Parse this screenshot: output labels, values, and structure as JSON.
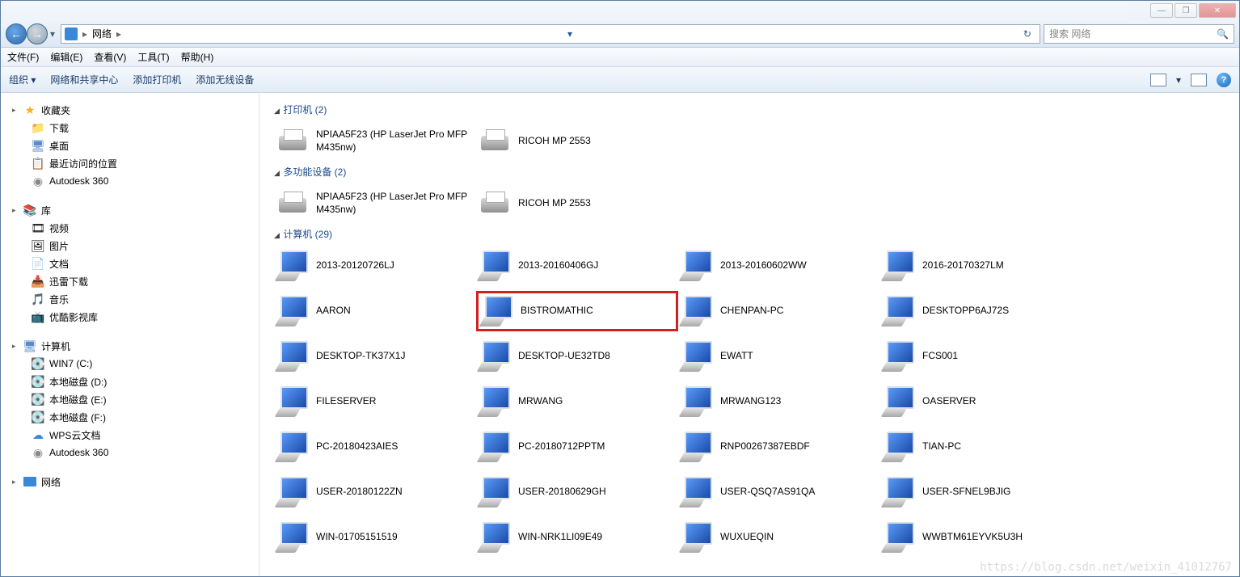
{
  "titlebar": {
    "min": "—",
    "max": "❐",
    "close": "✕"
  },
  "nav": {
    "back": "←",
    "forward": "→",
    "breadcrumb_root": "▸",
    "breadcrumb_loc": "网络",
    "breadcrumb_sep": "▸",
    "refresh": "↻",
    "search_placeholder": "搜索 网络",
    "search_icon": "🔍"
  },
  "menubar": {
    "file": "文件(F)",
    "edit": "编辑(E)",
    "view": "查看(V)",
    "tools": "工具(T)",
    "help": "帮助(H)"
  },
  "toolbar": {
    "organize": "组织 ▾",
    "network_center": "网络和共享中心",
    "add_printer": "添加打印机",
    "add_wireless": "添加无线设备",
    "help": "?"
  },
  "sidebar": {
    "favorites": {
      "label": "收藏夹",
      "items": [
        "下载",
        "桌面",
        "最近访问的位置",
        "Autodesk 360"
      ]
    },
    "libraries": {
      "label": "库",
      "items": [
        "视频",
        "图片",
        "文档",
        "迅雷下载",
        "音乐",
        "优酷影视库"
      ]
    },
    "computer": {
      "label": "计算机",
      "items": [
        "WIN7 (C:)",
        "本地磁盘 (D:)",
        "本地磁盘 (E:)",
        "本地磁盘 (F:)",
        "WPS云文档",
        "Autodesk 360"
      ]
    },
    "network": {
      "label": "网络"
    }
  },
  "content": {
    "groups": [
      {
        "header": "打印机 (2)",
        "type": "printer",
        "cols": 2,
        "items": [
          {
            "label": "NPIAA5F23 (HP LaserJet Pro MFP M435nw)"
          },
          {
            "label": "RICOH MP 2553"
          }
        ]
      },
      {
        "header": "多功能设备 (2)",
        "type": "printer",
        "cols": 2,
        "items": [
          {
            "label": "NPIAA5F23 (HP LaserJet Pro MFP M435nw)"
          },
          {
            "label": "RICOH MP 2553"
          }
        ]
      },
      {
        "header": "计算机 (29)",
        "type": "computer",
        "cols": 4,
        "items": [
          {
            "label": "2013-20120726LJ"
          },
          {
            "label": "2013-20160406GJ"
          },
          {
            "label": "2013-20160602WW"
          },
          {
            "label": "2016-20170327LM"
          },
          {
            "label": "AARON"
          },
          {
            "label": "BISTROMATHIC",
            "highlight": true
          },
          {
            "label": "CHENPAN-PC"
          },
          {
            "label": "DESKTOPP6AJ72S"
          },
          {
            "label": "DESKTOP-TK37X1J"
          },
          {
            "label": "DESKTOP-UE32TD8"
          },
          {
            "label": "EWATT"
          },
          {
            "label": "FCS001"
          },
          {
            "label": "FILESERVER"
          },
          {
            "label": "MRWANG"
          },
          {
            "label": "MRWANG123"
          },
          {
            "label": "OASERVER"
          },
          {
            "label": "PC-20180423AIES"
          },
          {
            "label": "PC-20180712PPTM"
          },
          {
            "label": "RNP00267387EBDF"
          },
          {
            "label": "TIAN-PC"
          },
          {
            "label": "USER-20180122ZN"
          },
          {
            "label": "USER-20180629GH"
          },
          {
            "label": "USER-QSQ7AS91QA"
          },
          {
            "label": "USER-SFNEL9BJIG"
          },
          {
            "label": "WIN-01705151519"
          },
          {
            "label": "WIN-NRK1LI09E49"
          },
          {
            "label": "WUXUEQIN"
          },
          {
            "label": "WWBTM61EYVK5U3H"
          }
        ]
      }
    ]
  },
  "watermark": "https://blog.csdn.net/weixin_41012767"
}
